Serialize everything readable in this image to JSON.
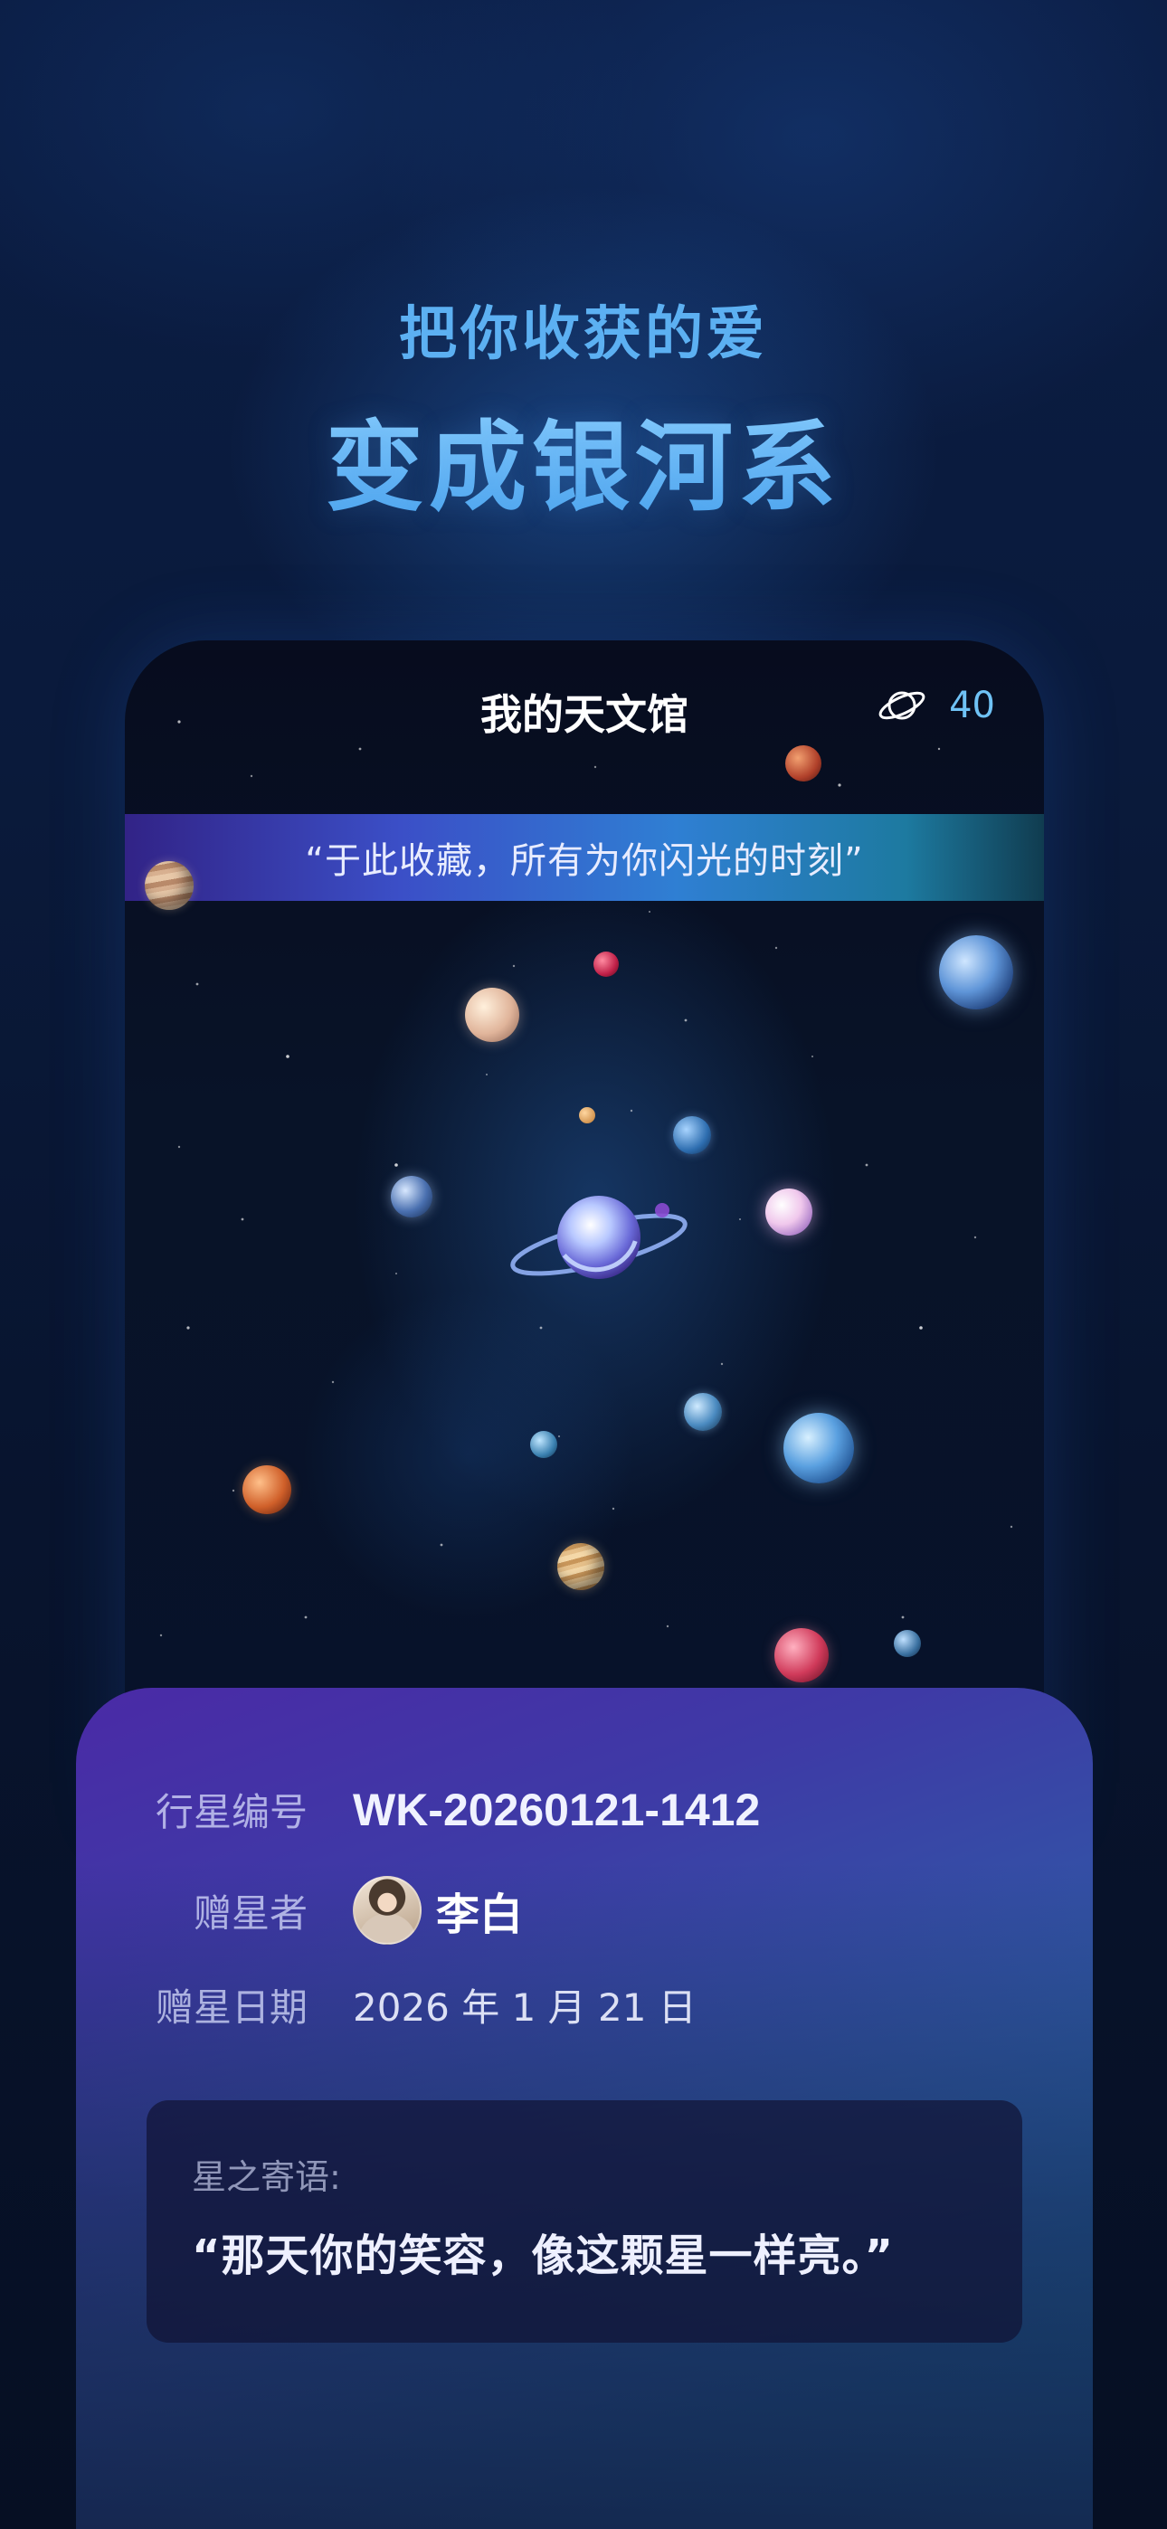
{
  "promo": {
    "line1": "把你收获的爱",
    "line2": "变成银河系"
  },
  "app": {
    "title": "我的天文馆",
    "planet_icon": "planet-ring-icon",
    "planet_count": "40",
    "quote": "“于此收藏，所有为你闪光的时刻”"
  },
  "planet_info": {
    "id_label": "行星编号",
    "id_value": "WK-20260121-1412",
    "giver_label": "赠星者",
    "giver_name": "李白",
    "date_label": "赠星日期",
    "date_value": "2026 年 1 月 21 日",
    "message_label": "星之寄语:",
    "message_text": "“那天你的笑容，像这颗星一样亮。”"
  },
  "colors": {
    "headline": "#5cb0f2",
    "counter": "#6fc2f5",
    "panel_start": "#4a2aa6",
    "panel_end": "#1b7ab0"
  }
}
